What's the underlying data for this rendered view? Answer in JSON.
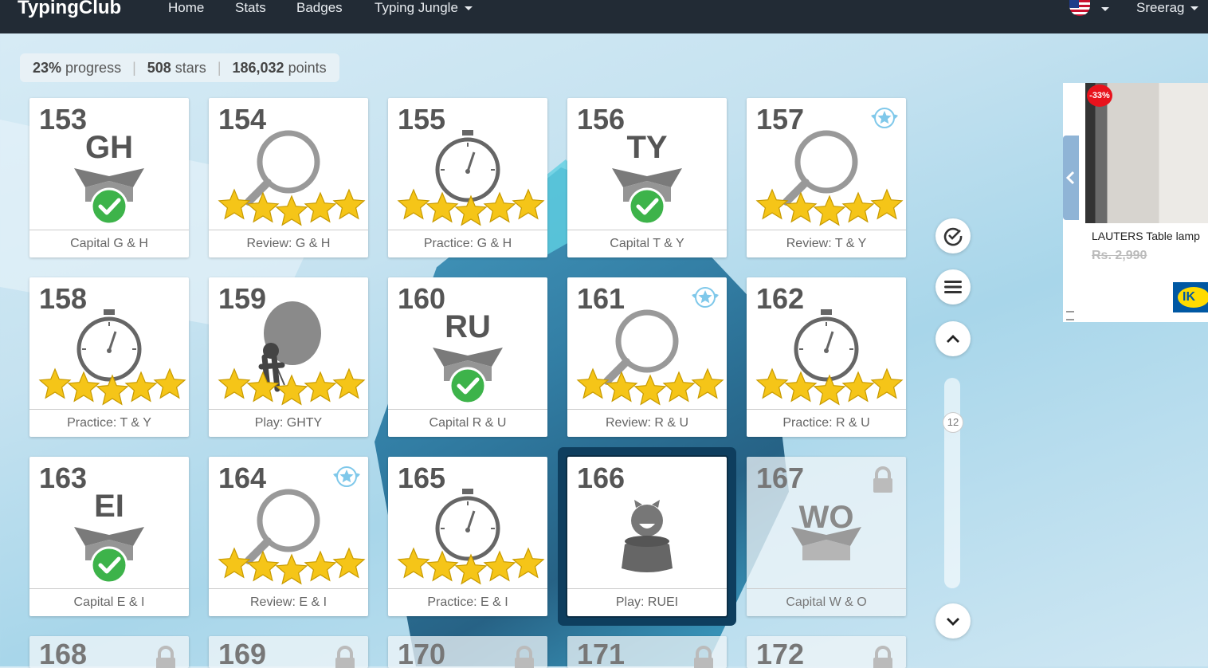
{
  "nav": {
    "brand": "TypingClub",
    "links": [
      "Home",
      "Stats",
      "Badges",
      "Typing Jungle"
    ],
    "user": "Sreerag"
  },
  "stats": {
    "progress_value": "23%",
    "progress_label": "progress",
    "stars_value": "508",
    "stars_label": "stars",
    "points_value": "186,032",
    "points_label": "points"
  },
  "lessons": [
    {
      "num": "153",
      "title": "Capital G & H",
      "icon": "letters-box-check-icon",
      "letters": "GH"
    },
    {
      "num": "154",
      "title": "Review: G & H",
      "icon": "magnifier-icon",
      "stars": 5
    },
    {
      "num": "155",
      "title": "Practice: G & H",
      "icon": "stopwatch-icon",
      "stars": 5
    },
    {
      "num": "156",
      "title": "Capital T & Y",
      "icon": "letters-box-check-icon",
      "letters": "TY"
    },
    {
      "num": "157",
      "title": "Review: T & Y",
      "icon": "magnifier-icon",
      "stars": 5,
      "badge": true
    },
    {
      "num": "158",
      "title": "Practice: T & Y",
      "icon": "stopwatch-icon",
      "stars": 5
    },
    {
      "num": "159",
      "title": "Play: GHTY",
      "icon": "balloon-game-icon",
      "stars": 5
    },
    {
      "num": "160",
      "title": "Capital R & U",
      "icon": "letters-box-check-icon",
      "letters": "RU"
    },
    {
      "num": "161",
      "title": "Review: R & U",
      "icon": "magnifier-icon",
      "stars": 5,
      "badge": true
    },
    {
      "num": "162",
      "title": "Practice: R & U",
      "icon": "stopwatch-icon",
      "stars": 5
    },
    {
      "num": "163",
      "title": "Capital E & I",
      "icon": "letters-box-check-icon",
      "letters": "EI"
    },
    {
      "num": "164",
      "title": "Review: E & I",
      "icon": "magnifier-icon",
      "stars": 5,
      "badge": true
    },
    {
      "num": "165",
      "title": "Practice: E & I",
      "icon": "stopwatch-icon",
      "stars": 5
    },
    {
      "num": "166",
      "title": "Play: RUEI",
      "icon": "jar-game-icon",
      "current": true
    },
    {
      "num": "167",
      "title": "Capital W & O",
      "icon": "letters-box-icon",
      "letters": "WO",
      "locked": true
    },
    {
      "num": "168",
      "locked": true
    },
    {
      "num": "169",
      "locked": true
    },
    {
      "num": "170",
      "locked": true
    },
    {
      "num": "171",
      "locked": true
    },
    {
      "num": "172",
      "locked": true
    }
  ],
  "side": {
    "scroll_position": "12"
  },
  "ad": {
    "discount": "-33%",
    "title": "LAUTERS Table lamp",
    "price": "Rs. 2,990",
    "logo": "IK"
  },
  "colors": {
    "nav_bg": "#222b35",
    "star": "#f5c518",
    "check": "#3db34a",
    "current_border": "#0e3e5e"
  }
}
